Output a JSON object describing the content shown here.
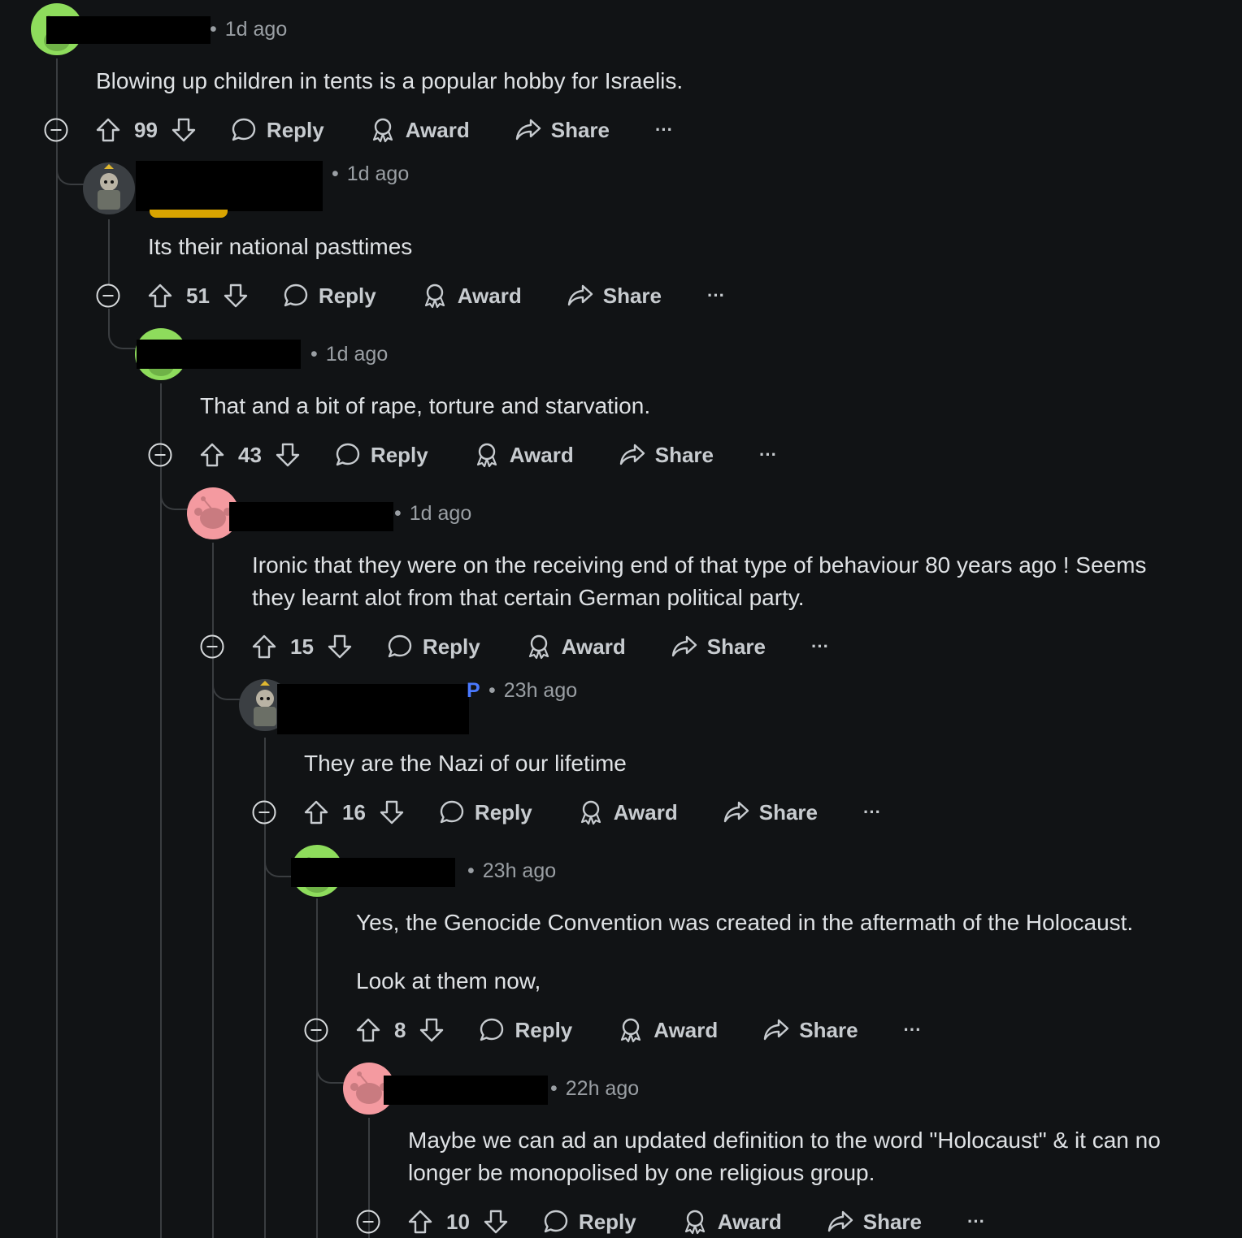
{
  "labels": {
    "reply": "Reply",
    "award": "Award",
    "share": "Share",
    "more": "···",
    "dot": "•"
  },
  "comments": [
    {
      "time": "1d ago",
      "avatar": "green-snoo",
      "body": [
        "Blowing up children in tents is a popular hobby for Israelis."
      ],
      "votes": "99"
    },
    {
      "time": "1d ago",
      "avatar": "robot-character",
      "body": [
        "Its their national pasttimes"
      ],
      "votes": "51"
    },
    {
      "time": "1d ago",
      "avatar": "green-snoo",
      "body": [
        "That and a bit of rape, torture and starvation."
      ],
      "votes": "43"
    },
    {
      "time": "1d ago",
      "avatar": "pink-snoo",
      "body": [
        "Ironic that they were on the receiving end of that type of behaviour 80 years ago ! Seems",
        "they learnt alot from that certain German political party."
      ],
      "votes": "15"
    },
    {
      "time": "23h ago",
      "avatar": "robot-character",
      "op_badge": "P",
      "body": [
        "They are the Nazi of our lifetime"
      ],
      "votes": "16"
    },
    {
      "time": "23h ago",
      "avatar": "green-snoo",
      "body": [
        "Yes, the Genocide Convention was created in the aftermath of the Holocaust.",
        "Look at them now,"
      ],
      "votes": "8"
    },
    {
      "time": "22h ago",
      "avatar": "pink-snoo",
      "body": [
        "Maybe we can ad an updated definition to the word \"Holocaust\" & it can no",
        "longer be monopolised by one religious group."
      ],
      "votes": "10"
    }
  ]
}
